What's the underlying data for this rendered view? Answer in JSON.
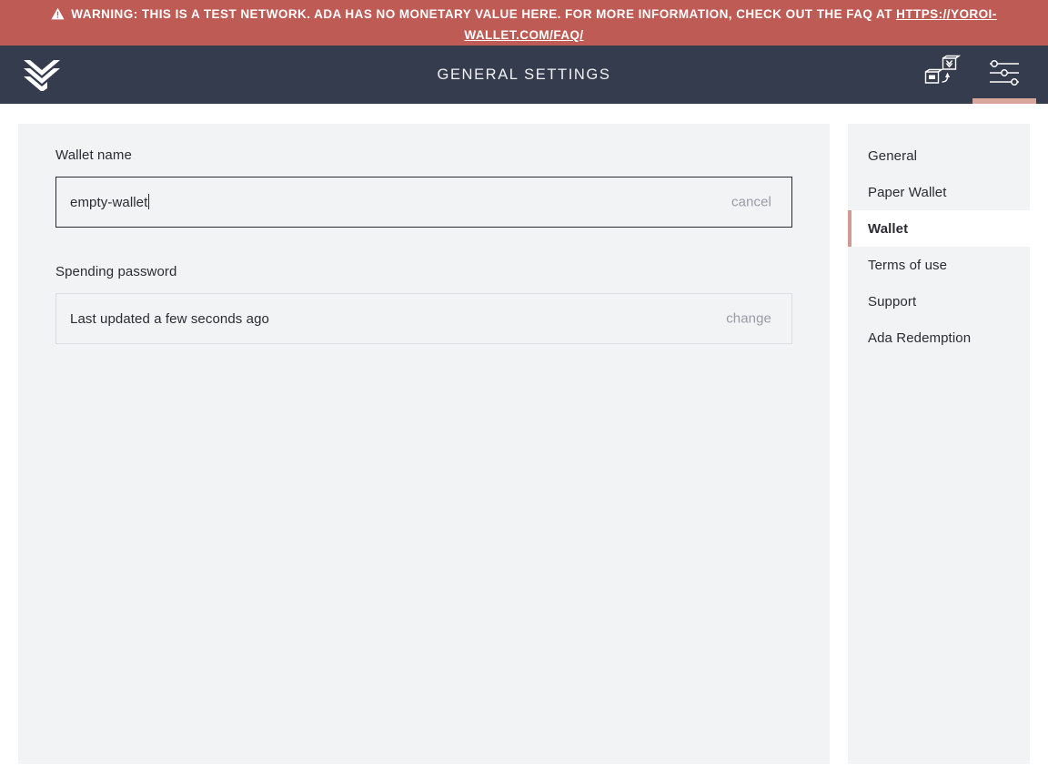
{
  "warning": {
    "icon": "warning-triangle-icon",
    "text": "WARNING: THIS IS A TEST NETWORK. ADA HAS NO MONETARY VALUE HERE. FOR MORE INFORMATION, CHECK OUT THE FAQ AT ",
    "link_text": "HTTPS://YOROI-WALLET.COM/FAQ/",
    "background_color": "#bf5b55",
    "text_color": "#ffffff"
  },
  "topbar": {
    "logo_name": "yoroi-logo",
    "title": "GENERAL SETTINGS",
    "background_color": "#353c4e",
    "wallet_switch_icon": "wallet-switch-icon",
    "settings_icon": "settings-sliders-icon",
    "active_indicator_color": "#d8a69d"
  },
  "main": {
    "wallet_name": {
      "label": "Wallet name",
      "value": "empty-wallet",
      "placeholder": "Wallet name",
      "action_label": "cancel",
      "focused": true
    },
    "spending_password": {
      "label": "Spending password",
      "value": "Last updated a few seconds ago",
      "action_label": "change"
    },
    "panel_background": "#f2f3f5"
  },
  "settings_menu": {
    "items": [
      {
        "label": "General",
        "active": false
      },
      {
        "label": "Paper Wallet",
        "active": false
      },
      {
        "label": "Wallet",
        "active": true
      },
      {
        "label": "Terms of use",
        "active": false
      },
      {
        "label": "Support",
        "active": false
      },
      {
        "label": "Ada Redemption",
        "active": false
      }
    ],
    "active_border_color": "#cf9a92"
  }
}
